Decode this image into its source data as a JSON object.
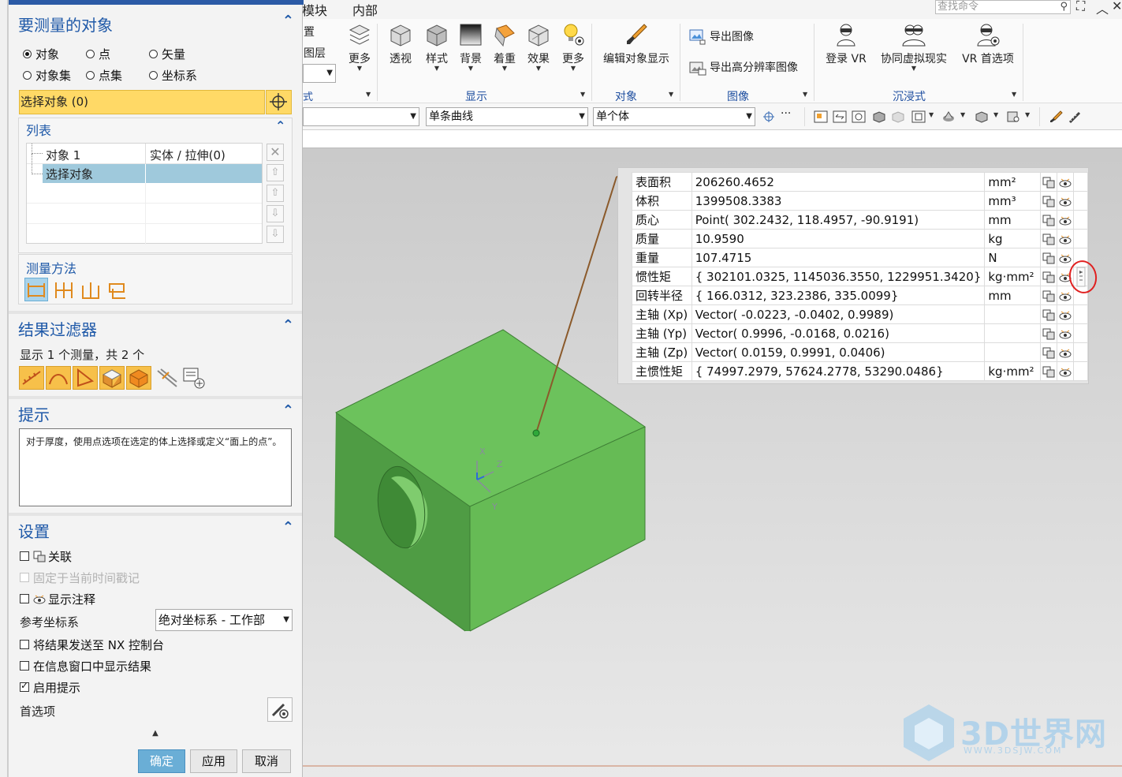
{
  "top_menu": {
    "tab_partial": "模块",
    "tab_internal": "内部",
    "search_placeholder": "查找命令"
  },
  "ribbon": {
    "partial_labels": [
      "置",
      "图层",
      "式"
    ],
    "buttons": [
      {
        "label": "更多"
      },
      {
        "label": "透视"
      },
      {
        "label": "样式"
      },
      {
        "label": "背景"
      },
      {
        "label": "着重"
      },
      {
        "label": "效果"
      },
      {
        "label": "更多"
      },
      {
        "label": "编辑对象显示"
      },
      {
        "label": "登录 VR"
      },
      {
        "label": "协同虚拟现实"
      },
      {
        "label": "VR 首选项"
      }
    ],
    "image_items": [
      "导出图像",
      "导出高分辨率图像"
    ],
    "groups": [
      "显示",
      "对象",
      "图像",
      "沉浸式"
    ]
  },
  "selection_bar": {
    "curve_rule": "单条曲线",
    "body_rule": "单个体",
    "more": "···"
  },
  "dialog": {
    "section_target": "要测量的对象",
    "radios": [
      {
        "label": "对象",
        "checked": true
      },
      {
        "label": "点",
        "checked": false
      },
      {
        "label": "矢量",
        "checked": false
      },
      {
        "label": "对象集",
        "checked": false
      },
      {
        "label": "点集",
        "checked": false
      },
      {
        "label": "坐标系",
        "checked": false
      }
    ],
    "select_object": "选择对象 (0)",
    "list_header": "列表",
    "list_rows": [
      {
        "name": "对象 1",
        "type": "实体 / 拉伸(0)"
      },
      {
        "name": "选择对象",
        "type": ""
      }
    ],
    "measure_method": "测量方法",
    "section_filter": "结果过滤器",
    "filter_summary": "显示 1 个测量，共 2 个",
    "section_hint": "提示",
    "hint_text": "对于厚度，使用点选项在选定的体上选择或定义“面上的点”。",
    "section_settings": "设置",
    "settings": {
      "associative": "关联",
      "fixed_time": "固定于当前时间戳记",
      "show_annotation": "显示注释",
      "ref_csys_label": "参考坐标系",
      "ref_csys_value": "绝对坐标系 - 工作部",
      "send_nx_console": "将结果发送至 NX 控制台",
      "show_info_window": "在信息窗口中显示结果",
      "enable_hint": "启用提示",
      "preferences": "首选项"
    },
    "buttons": {
      "ok": "确定",
      "apply": "应用",
      "cancel": "取消"
    }
  },
  "results": {
    "rows": [
      {
        "name": "表面积",
        "value": "206260.4652",
        "unit": "mm²"
      },
      {
        "name": "体积",
        "value": "1399508.3383",
        "unit": "mm³"
      },
      {
        "name": "质心",
        "value": "Point( 302.2432, 118.4957, -90.9191)",
        "unit": "mm"
      },
      {
        "name": "质量",
        "value": "10.9590",
        "unit": "kg"
      },
      {
        "name": "重量",
        "value": "107.4715",
        "unit": "N"
      },
      {
        "name": "惯性矩",
        "value": "{ 302101.0325, 1145036.3550, 1229951.3420}",
        "unit": "kg·mm²"
      },
      {
        "name": "回转半径",
        "value": "{ 166.0312, 323.2386, 335.0099}",
        "unit": "mm"
      },
      {
        "name": "主轴 (Xp)",
        "value": "Vector( -0.0223, -0.0402, 0.9989)",
        "unit": ""
      },
      {
        "name": "主轴 (Yp)",
        "value": "Vector( 0.9996, -0.0168, 0.0216)",
        "unit": ""
      },
      {
        "name": "主轴 (Zp)",
        "value": "Vector( 0.0159, 0.9991, 0.0406)",
        "unit": ""
      },
      {
        "name": "主惯性矩",
        "value": "{ 74997.2979, 57624.2778, 53290.0486}",
        "unit": "kg·mm²"
      }
    ]
  },
  "triad": {
    "x": "X",
    "y": "Y",
    "z": "Z"
  },
  "watermark": {
    "brand": "3D世界网",
    "url": "WWW.3DSJW.COM"
  },
  "colors": {
    "accent": "#1f59a8",
    "highlight": "#ffd966",
    "model": "#6bbf5a",
    "list_selected": "#9fc9dc"
  }
}
